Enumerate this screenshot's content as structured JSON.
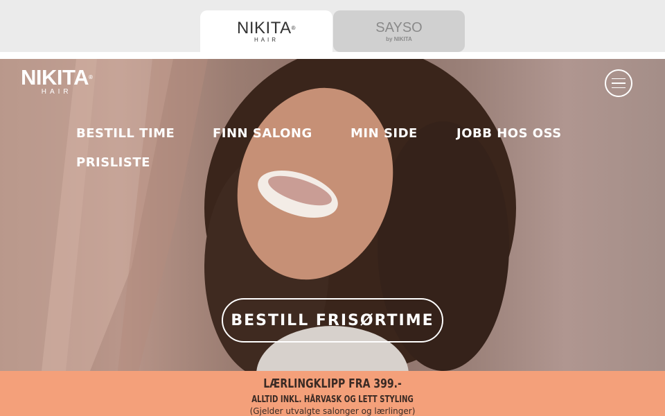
{
  "brand_tabs": [
    {
      "name": "NIKITA",
      "sub": "HAIR",
      "active": true
    },
    {
      "name": "SAYSO",
      "sub": "by NIKITA",
      "active": false
    }
  ],
  "hero": {
    "logo": {
      "main": "NIKITA",
      "sub": "HAIR"
    },
    "menu_icon": "hamburger-icon",
    "nav": [
      "BESTILL TIME",
      "FINN SALONG",
      "MIN SIDE",
      "JOBB HOS OSS",
      "PRISLISTE"
    ],
    "cta_label": "BESTILL FRISØRTIME"
  },
  "promo": {
    "line1": "LÆRLINGKLIPP FRA 399.-",
    "line2": "ALLTID INKL. HÅRVASK OG LETT STYLING",
    "line3": "(Gjelder utvalgte salonger og lærlinger)"
  },
  "colors": {
    "promo_bg": "#f4a07a",
    "tab_bg": "#ebebeb",
    "inactive_tab": "#d0d0d0"
  }
}
